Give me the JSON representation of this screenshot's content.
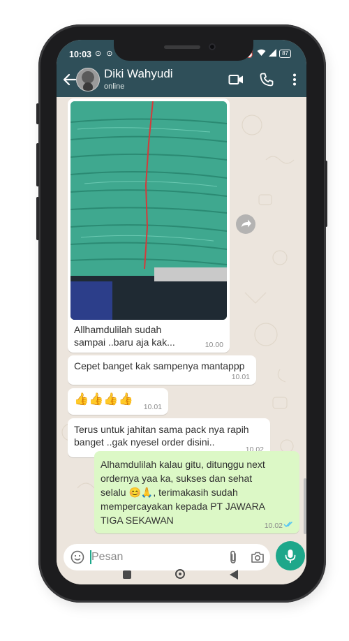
{
  "status_bar": {
    "time": "10:03",
    "battery": "87"
  },
  "header": {
    "contact_name": "Diki Wahyudi",
    "contact_status": "online"
  },
  "icons": {
    "back": "arrow-left-icon",
    "video": "video-call-icon",
    "call": "phone-icon",
    "menu": "more-vertical-icon",
    "forward": "forward-icon",
    "emoji": "emoji-icon",
    "attach": "paperclip-icon",
    "camera": "camera-icon",
    "mic": "microphone-icon"
  },
  "messages": [
    {
      "direction": "in",
      "type": "image",
      "caption": "Allhamdulilah sudah\nsampai ..baru aja kak...",
      "time": "10.00"
    },
    {
      "direction": "in",
      "type": "text",
      "text": "Cepet banget kak sampenya mantappp",
      "time": "10.01"
    },
    {
      "direction": "in",
      "type": "text",
      "text": "👍👍👍👍",
      "time": "10.01"
    },
    {
      "direction": "in",
      "type": "text",
      "text": "Terus untuk jahitan sama pack nya rapih\nbanget ..gak nyesel order disini..",
      "time": "10.02"
    },
    {
      "direction": "out",
      "type": "text",
      "text": "Alhamdulilah kalau gitu, ditunggu next\nordernya yaa ka, sukses dan sehat\nselalu 😊🙏, terimakasih sudah\nmempercayakan kepada PT JAWARA\nTIGA SEKAWAN",
      "time": "10.02",
      "read": true
    }
  ],
  "input": {
    "placeholder": "Pesan"
  },
  "colors": {
    "header": "#2f4f59",
    "outgoing_bubble": "#dcf8c6",
    "incoming_bubble": "#ffffff",
    "mic_button": "#1da78a",
    "read_ticks": "#4fc3f7"
  }
}
